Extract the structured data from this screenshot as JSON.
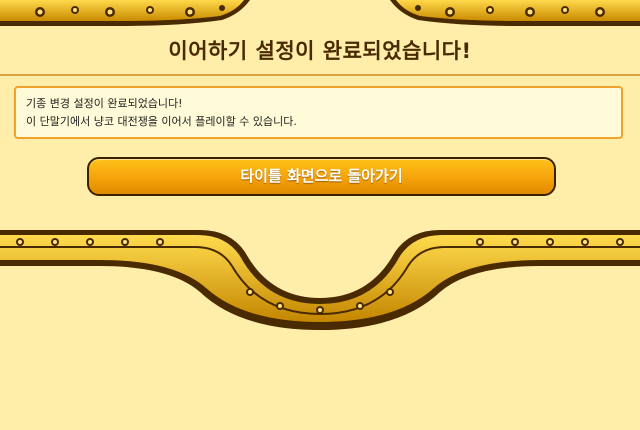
{
  "dialog": {
    "title": "이어하기 설정이 완료되었습니다!",
    "message_line1": "기종 변경 설정이 완료되었습니다!",
    "message_line2": "이 단말기에서 냥코 대전쟁을 이어서 플레이할 수 있습니다.",
    "back_button_label": "타이틀 화면으로 돌아가기"
  },
  "colors": {
    "background": "#ffedaa",
    "title_text": "#4a2a00",
    "message_border": "#f0a22a",
    "button_fill": "#f5a20a",
    "ornament_gold": "#e0a800",
    "ornament_dark": "#4a2a00"
  },
  "icons": {
    "top_ornament": "gold-scroll-ornament",
    "bottom_ornament": "gold-arch-ornament"
  }
}
